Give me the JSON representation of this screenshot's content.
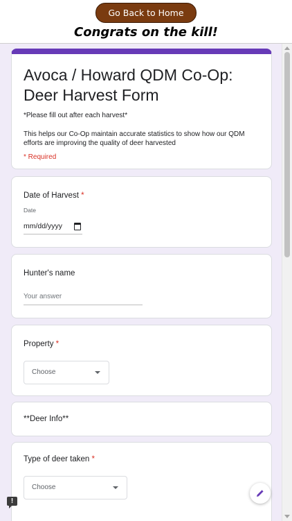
{
  "header": {
    "back_button": "Go Back to Home Screen",
    "congrats": "Congrats on the kill!"
  },
  "form": {
    "title": "Avoca / Howard QDM Co-Op: Deer Harvest Form",
    "instruction": "*Please fill out after each harvest*",
    "description": "This helps our Co-Op maintain accurate statistics to show how our QDM efforts are improving the quality of deer harvested",
    "required_note": "* Required",
    "accent_color": "#673ab7"
  },
  "questions": {
    "date": {
      "label": "Date of Harvest",
      "required_mark": "*",
      "sublabel": "Date",
      "value": "mm/dd/yyyy"
    },
    "hunter": {
      "label": "Hunter's name",
      "placeholder": "Your answer"
    },
    "property": {
      "label": "Property",
      "required_mark": "*",
      "selected": "Choose"
    },
    "deer_info": {
      "label": "**Deer Info**"
    },
    "deer_type": {
      "label": "Type of deer taken",
      "required_mark": "*",
      "selected": "Choose"
    }
  },
  "icons": {
    "calendar": "calendar-icon",
    "dropdown": "chevron-down-icon",
    "edit": "pencil-icon",
    "feedback": "feedback-icon"
  }
}
